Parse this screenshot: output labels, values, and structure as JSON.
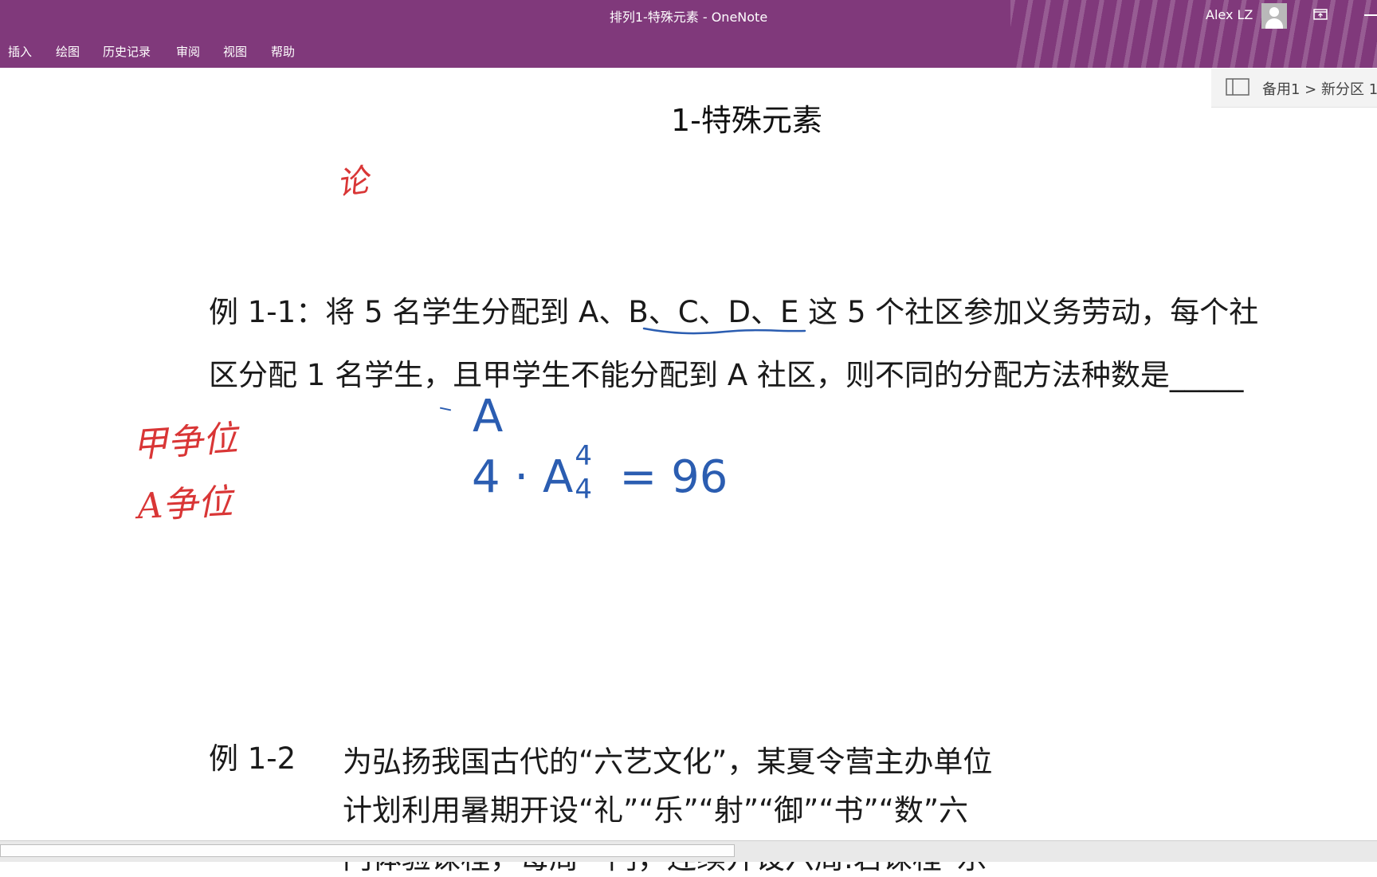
{
  "window": {
    "title": "排列1-特殊元素  -  OneNote",
    "user": "Alex LZ"
  },
  "menu": [
    "插入",
    "绘图",
    "历史记录",
    "审阅",
    "视图",
    "帮助"
  ],
  "breadcrumb": "备用1 > 新分区 1",
  "page": {
    "title": "1-特殊元素"
  },
  "problem1": {
    "label": "例 1-1",
    "line1": "：将 5 名学生分配到 A、B、C、D、E 这 5 个社区参加义务劳动，每个社",
    "line2": "区分配 1 名学生，且甲学生不能分配到 A 社区，则不同的分配方法种数是_____"
  },
  "problem2": {
    "label": "例 1-2",
    "line1": "为弘扬我国古代的“六艺文化”，某夏令营主办单位",
    "line2": "计划利用暑期开设“礼”“乐”“射”“御”“书”“数”六",
    "line3": "门体验课程，每周一门，连续开设六周.若课程“乐”"
  },
  "annotations": {
    "note_top": "论",
    "red_note1": "甲争位",
    "red_note2": "A争位",
    "blue_A": "A",
    "formula_left": "4 · A",
    "formula_sup": "4",
    "formula_sub": "4",
    "formula_right": "= 96"
  },
  "colors": {
    "titlebar": "#80397b",
    "ink_red": "#d93636",
    "ink_blue": "#2b5db1"
  }
}
